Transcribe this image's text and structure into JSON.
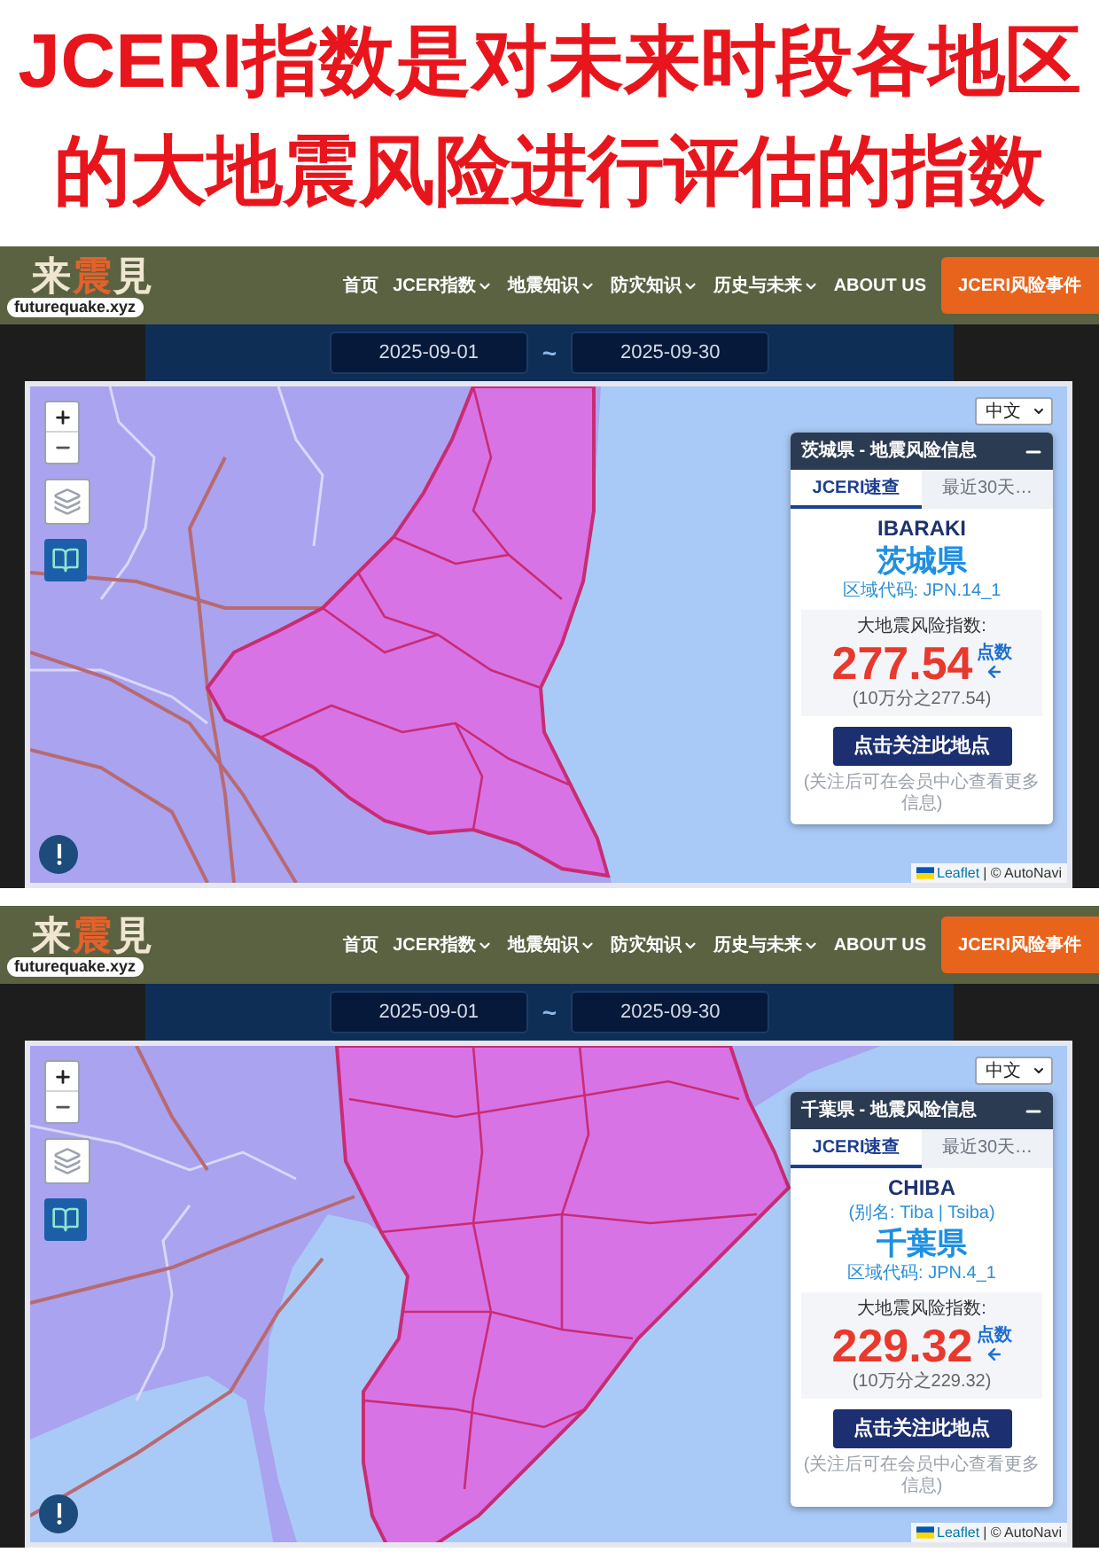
{
  "headline": {
    "lines": [
      "JCERI指数是对未来时段各地区",
      "的大地震风险进行评估的指数"
    ]
  },
  "screens": [
    {
      "header": {
        "logo": {
          "glyphs": [
            {
              "text": "来",
              "color": "#efe6d2"
            },
            {
              "text": "震",
              "color": "#e2622b"
            },
            {
              "text": "見",
              "color": "#efe6d2"
            }
          ],
          "domain": "futurequake.xyz"
        },
        "nav": [
          {
            "label": "首页",
            "dropdown": false
          },
          {
            "label": "JCER指数",
            "dropdown": true
          },
          {
            "label": "地震知识",
            "dropdown": true
          },
          {
            "label": "防灾知识",
            "dropdown": true
          },
          {
            "label": "历史与未来",
            "dropdown": true
          },
          {
            "label": "ABOUT US",
            "dropdown": false
          }
        ],
        "cta": "JCERI风险事件"
      },
      "date_range": {
        "start": "2025-09-01",
        "separator": "~",
        "end": "2025-09-30"
      },
      "map": {
        "language": "中文",
        "info_panel": {
          "title": "茨城県 - 地震风险信息",
          "tabs": [
            {
              "label": "JCERI速查",
              "selected": true
            },
            {
              "label": "最近30天…",
              "selected": false
            }
          ],
          "romaji": "IBARAKI",
          "name": "茨城県",
          "region_code": "区域代码: JPN.14_1",
          "index_label": "大地震风险指数:",
          "index_value": "277.54",
          "index_unit": "点数",
          "index_note": "(10万分之277.54)",
          "follow_button": "点击关注此地点",
          "follow_note": "(关注后可在会员中心查看更多信息)"
        },
        "attribution": {
          "link": "Leaflet",
          "text": "| © AutoNavi"
        }
      }
    },
    {
      "header": {
        "logo": {
          "glyphs": [
            {
              "text": "来",
              "color": "#efe6d2"
            },
            {
              "text": "震",
              "color": "#e2622b"
            },
            {
              "text": "見",
              "color": "#efe6d2"
            }
          ],
          "domain": "futurequake.xyz"
        },
        "nav": [
          {
            "label": "首页",
            "dropdown": false
          },
          {
            "label": "JCER指数",
            "dropdown": true
          },
          {
            "label": "地震知识",
            "dropdown": true
          },
          {
            "label": "防灾知识",
            "dropdown": true
          },
          {
            "label": "历史与未来",
            "dropdown": true
          },
          {
            "label": "ABOUT US",
            "dropdown": false
          }
        ],
        "cta": "JCERI风险事件"
      },
      "date_range": {
        "start": "2025-09-01",
        "separator": "~",
        "end": "2025-09-30"
      },
      "map": {
        "language": "中文",
        "info_panel": {
          "title": "千葉県 - 地震风险信息",
          "tabs": [
            {
              "label": "JCERI速查",
              "selected": true
            },
            {
              "label": "最近30天…",
              "selected": false
            }
          ],
          "romaji": "CHIBA",
          "alias": "(别名: Tiba | Tsiba)",
          "name": "千葉県",
          "region_code": "区域代码: JPN.4_1",
          "index_label": "大地震风险指数:",
          "index_value": "229.32",
          "index_unit": "点数",
          "index_note": "(10万分之229.32)",
          "follow_button": "点击关注此地点",
          "follow_note": "(关注后可在会员中心查看更多信息)"
        },
        "attribution": {
          "link": "Leaflet",
          "text": "| © AutoNavi"
        }
      }
    }
  ]
}
